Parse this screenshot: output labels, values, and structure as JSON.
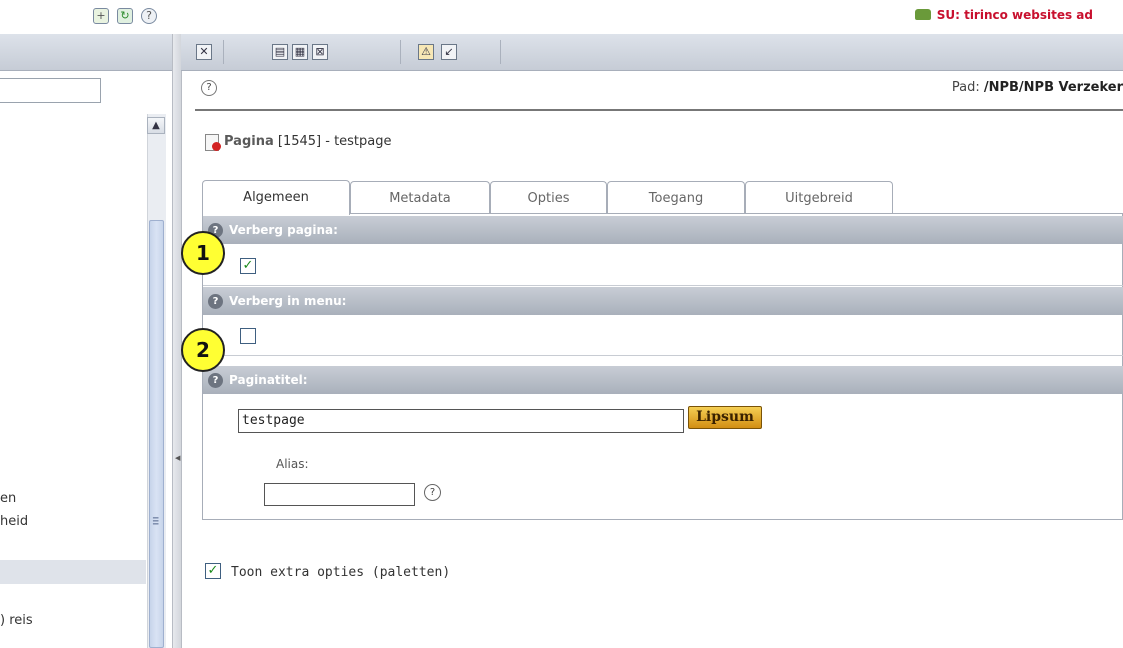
{
  "user_bar": {
    "text": "SU: tirinco websites ad",
    "bag_icon": "bag-icon"
  },
  "left_panel": {
    "toolbar_icons": [
      "new-page-icon",
      "refresh-icon",
      "help-icon"
    ],
    "tree_items": [
      "en",
      "heid",
      ") reis"
    ]
  },
  "right_toolbar": {
    "icons": [
      "close-icon",
      "save-icon",
      "save-view-icon",
      "save-close-icon",
      "clear-cache-icon",
      "open-list-icon"
    ]
  },
  "path": {
    "label": "Pad:",
    "value": "/NPB/NPB Verzeker"
  },
  "help_symbol": "?",
  "page": {
    "name": "Pagina",
    "rest": " [1545] - testpage"
  },
  "tabs": [
    {
      "label": "Algemeen",
      "active": true
    },
    {
      "label": "Metadata",
      "active": false
    },
    {
      "label": "Opties",
      "active": false
    },
    {
      "label": "Toegang",
      "active": false
    },
    {
      "label": "Uitgebreid",
      "active": false
    }
  ],
  "sections": {
    "hide_page": {
      "label": "Verberg pagina:",
      "checked": true
    },
    "hide_in_menu": {
      "label": "Verberg in menu:",
      "checked": false
    },
    "page_title": {
      "label": "Paginatitel:",
      "value": "testpage",
      "lipsum_label": "Lipsum"
    },
    "alias": {
      "label": "Alias:",
      "value": ""
    }
  },
  "extra_options": {
    "label": "Toon extra opties (paletten)",
    "checked": true
  },
  "callouts": [
    "1",
    "2"
  ],
  "colors": {
    "section_bar": "#a9b0bb",
    "su_text": "#c8102e",
    "callout": "#ffff33",
    "check": "#1b8a1b"
  }
}
